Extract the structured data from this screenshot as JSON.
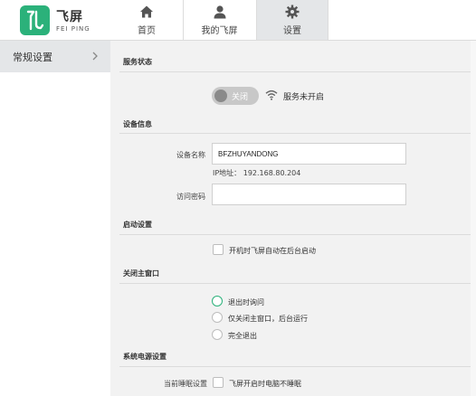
{
  "brand": {
    "name_cn": "飞屏",
    "name_en": "FEI PING"
  },
  "nav": {
    "tabs": [
      {
        "label": "首页",
        "icon": "home-icon"
      },
      {
        "label": "我的飞屏",
        "icon": "user-icon"
      },
      {
        "label": "设置",
        "icon": "gear-icon",
        "active": true
      }
    ]
  },
  "sidebar": {
    "items": [
      {
        "label": "常规设置",
        "icon": "chevron-right-icon",
        "active": true
      }
    ]
  },
  "service": {
    "title": "服务状态",
    "toggle_label": "关闭",
    "toggle_on": false,
    "status_text": "服务未开启",
    "icon": "wifi-icon"
  },
  "device": {
    "title": "设备信息",
    "name_label": "设备名称",
    "name_value": "BFZHUYANDONG",
    "ip_text": "IP地址： 192.168.80.204",
    "password_label": "访问密码",
    "password_value": ""
  },
  "startup": {
    "title": "启动设置",
    "option_label": "开机时飞屏自动在后台启动",
    "checked": false
  },
  "close_window": {
    "title": "关闭主窗口",
    "options": [
      {
        "label": "退出时询问",
        "selected": true
      },
      {
        "label": "仅关闭主窗口，后台运行",
        "selected": false
      },
      {
        "label": "完全退出",
        "selected": false
      }
    ]
  },
  "power": {
    "title": "系统电源设置",
    "field_label": "当前睡眠设置",
    "option_label": "飞屏开启时电脑不睡眠",
    "checked": false
  },
  "colors": {
    "accent": "#2bb17a",
    "active_bg": "#e4e6e8",
    "toggle_off": "#c8c8c8"
  }
}
